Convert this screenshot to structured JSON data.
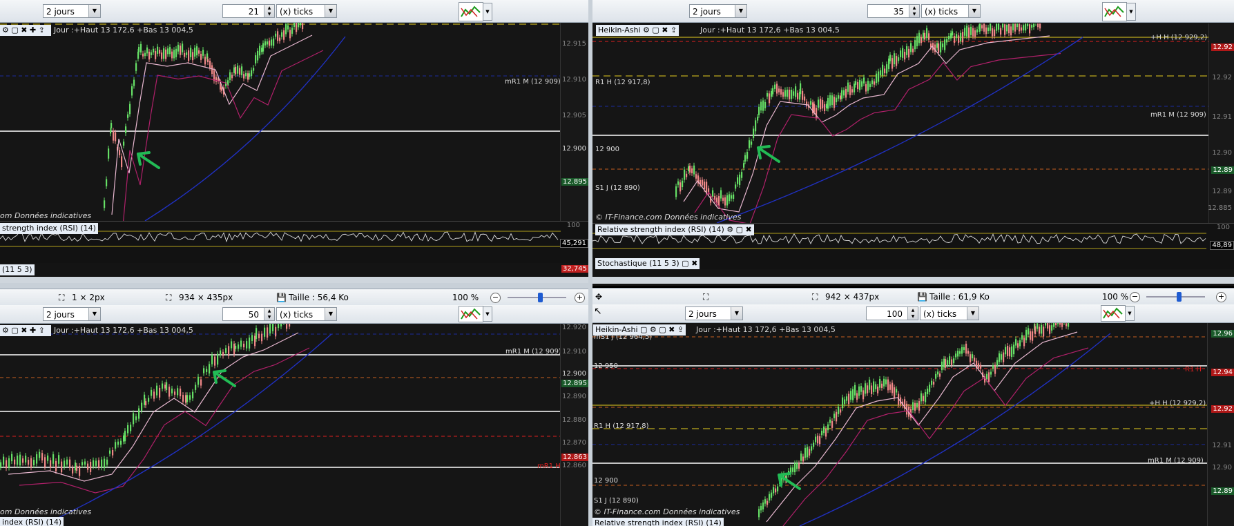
{
  "panels": [
    {
      "period": "2 jours",
      "interval": "21",
      "interval_unit": "(x) ticks",
      "legend": "",
      "jour": "Jour :+Haut 13 172,6 +Bas 13 004,5",
      "levels": [
        {
          "label": "mR1 M (12 909)"
        }
      ],
      "axis": [
        "12.915",
        "12.910",
        "12.905",
        "12.900"
      ],
      "price_boxes": [
        "12.895"
      ],
      "credit": "om Données indicatives",
      "rsi_label": "strength index (RSI) (14)",
      "rsi_top": "100",
      "rsi_value": "45,291",
      "stoch_label": "(11 5 3)",
      "stoch_value": "32,745"
    },
    {
      "period": "2 jours",
      "interval": "35",
      "interval_unit": "(x) ticks",
      "legend": "Heikin-Ashi",
      "jour": "Jour :+Haut 13 172,6 +Bas 13 004,5",
      "levels": [
        {
          "label": "+H H (12 929,2)"
        },
        {
          "label": "R1 H (12 917,8)"
        },
        {
          "label": "mR1 M (12 909)"
        },
        {
          "label": "12 900"
        },
        {
          "label": "S1 J (12 890)"
        }
      ],
      "axis": [
        "12.92",
        "12.91",
        "12.90",
        "12.89",
        "12.885"
      ],
      "price_boxes": [
        "12.92",
        "12.89"
      ],
      "credit": "© IT-Finance.com  Données indicatives",
      "rsi_label": "Relative strength index (RSI) (14)",
      "rsi_top": "100",
      "rsi_value": "48,89",
      "stoch_label": "Stochastique (11 5 3)"
    },
    {
      "period": "2 jours",
      "interval": "50",
      "interval_unit": "(x) ticks",
      "legend": "",
      "jour": "Jour :+Haut 13 172,6 +Bas 13 004,5",
      "levels": [
        {
          "label": "mR1 M (12 909)"
        },
        {
          "label": "mR1 H"
        }
      ],
      "axis": [
        "12.920",
        "12.910",
        "12.900",
        "12.890",
        "12.880",
        "12.870",
        "12.860"
      ],
      "price_boxes": [
        "12.900",
        "12.895",
        "12.863"
      ],
      "credit": "om  Données indicatives",
      "rsi_label": "index (RSI) (14)"
    },
    {
      "period": "2 jours",
      "interval": "100",
      "interval_unit": "(x) ticks",
      "legend": "Heikin-Ashi",
      "jour": "Jour :+Haut 13 172,6 +Bas 13 004,5",
      "levels": [
        {
          "label": "mS1 J (12 964,5)"
        },
        {
          "label": "12 950"
        },
        {
          "label": "R1 H"
        },
        {
          "label": "+H H (12 929,2)"
        },
        {
          "label": "R1 H (12 917,8)"
        },
        {
          "label": "mR1 M (12 909)"
        },
        {
          "label": "12 900"
        },
        {
          "label": "S1 J (12 890)"
        }
      ],
      "axis": [
        "12.96",
        "12.94",
        "12.92",
        "12.91",
        "12.90",
        "12.89"
      ],
      "price_boxes": [
        "12.96",
        "12.94",
        "12.92",
        "12.89"
      ],
      "credit": "© IT-Finance.com  Données indicatives",
      "rsi_label": "Relative strength index (RSI) (14)"
    }
  ],
  "statusbars": [
    {
      "pixel": "1 × 2px",
      "size": "934 × 435px",
      "weight": "Taille : 56,4 Ko",
      "zoom": "100 %",
      "zoom_level": 0.55
    },
    {
      "pixel": "",
      "size": "942 × 437px",
      "weight": "Taille : 61,9 Ko",
      "zoom": "100 %",
      "zoom_level": 0.55
    }
  ],
  "colors": {
    "bull": "#66e066",
    "bear": "#f08888",
    "ma_fast": "#e8b8d0",
    "ma_slow": "#b0206a",
    "ma_long": "#2030c0",
    "yellow": "#e8d020",
    "navy": "#1a2aa0",
    "orange": "#c86020",
    "white": "#ffffff",
    "red": "#e02020",
    "arrow": "#22bb55"
  }
}
